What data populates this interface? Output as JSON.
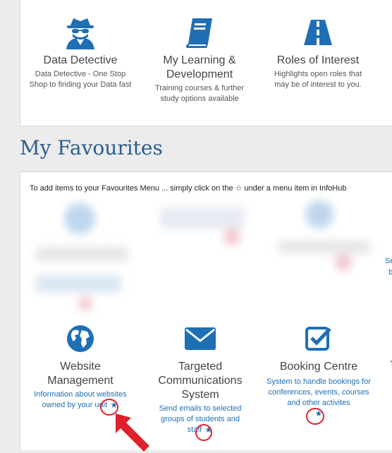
{
  "top_tiles": [
    {
      "title": "Data Detective",
      "desc": "Data Detective - One Stop Shop to finding your Data fast",
      "icon": "spy-icon"
    },
    {
      "title": "My Learning & Development",
      "desc": "Training courses & further study options available",
      "icon": "book-icon"
    },
    {
      "title": "Roles of Interest",
      "desc": "Highlights open roles that may be of interest to you.",
      "icon": "road-icon"
    }
  ],
  "favourites": {
    "heading": "My Favourites",
    "intro": "To add items to your Favourites Menu ... simply click on the ☆ under a menu item in InfoHub",
    "items": [
      {
        "title": "Website Management",
        "desc": "Information about websites owned by your unit",
        "icon": "globe-icon"
      },
      {
        "title": "Targeted Communications System",
        "desc": "Send emails to selected groups of students and staff",
        "icon": "envelope-icon"
      },
      {
        "title": "Booking Centre",
        "desc": "System to handle bookings for conferences, events, courses and other activites",
        "icon": "checkbox-icon"
      }
    ],
    "star_glyph": "★",
    "offscreen_fragments": [
      "Se",
      "b",
      "T"
    ]
  },
  "colors": {
    "accent": "#1f6fb5",
    "heading": "#2c5d8f",
    "annotation": "#e0202a"
  }
}
